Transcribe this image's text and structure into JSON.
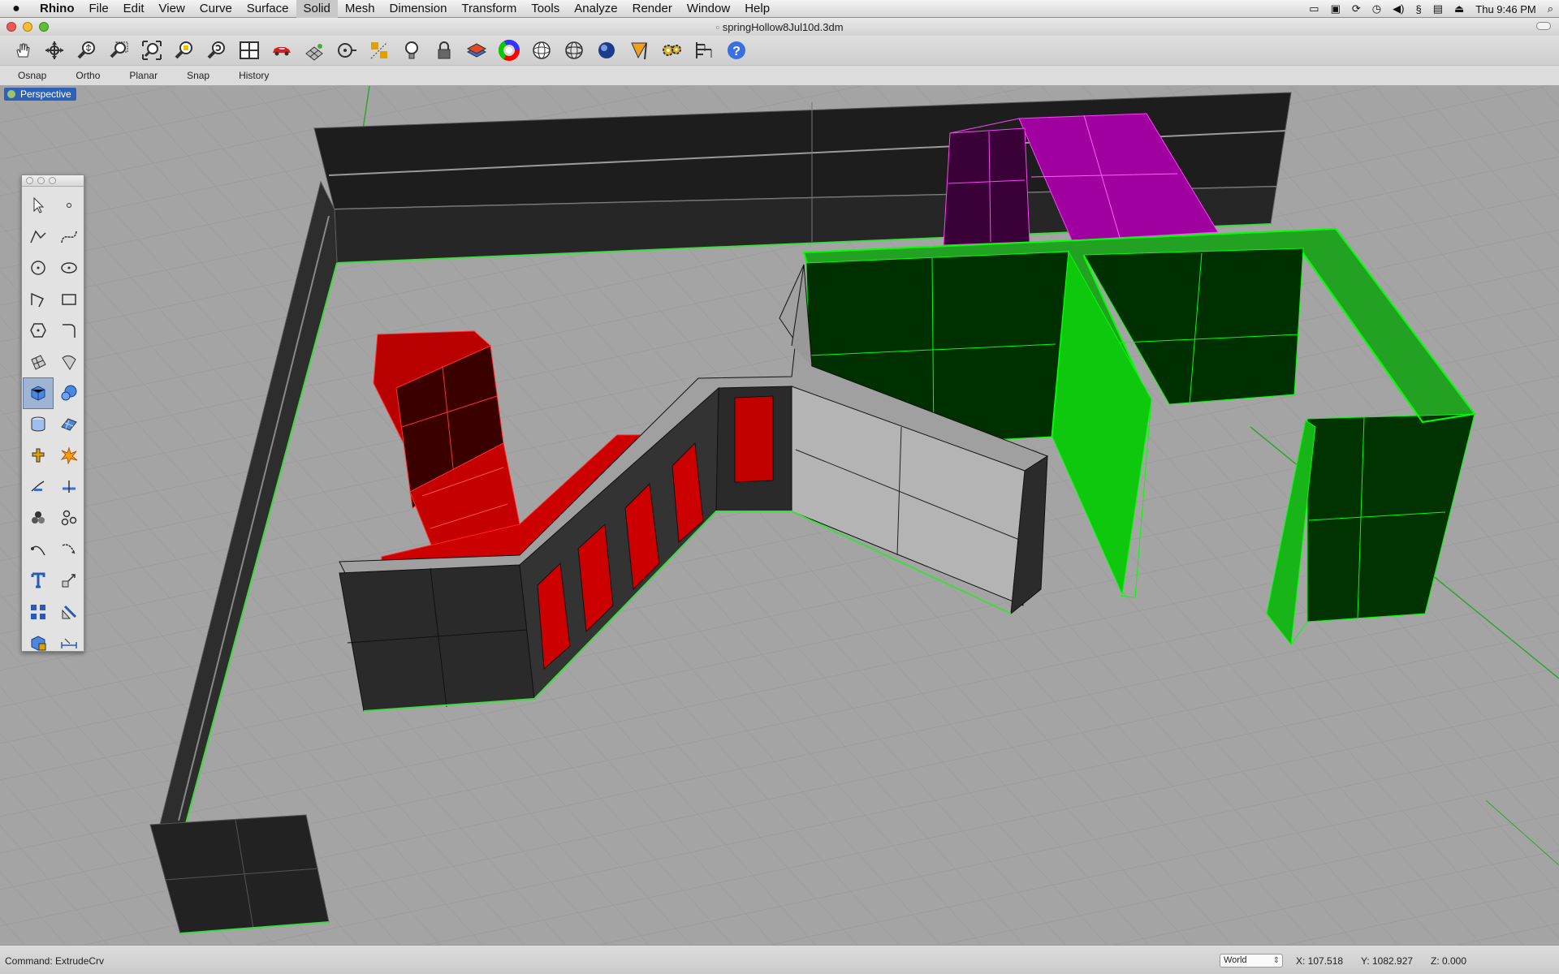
{
  "menubar": {
    "apple": "",
    "app": "Rhino",
    "items": [
      "File",
      "Edit",
      "View",
      "Curve",
      "Surface",
      "Solid",
      "Mesh",
      "Dimension",
      "Transform",
      "Tools",
      "Analyze",
      "Render",
      "Window",
      "Help"
    ],
    "active": "Solid",
    "clock": "Thu 9:46 PM"
  },
  "window": {
    "title": "springHollow8Jul10d.3dm"
  },
  "toolbar": {
    "icons": [
      "pan-icon",
      "rotate-view-icon",
      "zoom-dynamic-icon",
      "zoom-window-icon",
      "zoom-extents-icon",
      "zoom-selected-icon",
      "undo-view-icon",
      "four-viewports-icon",
      "car-icon",
      "grid-plane-icon",
      "cplane-icon",
      "snap-grid-icon",
      "light-icon",
      "lock-icon",
      "layer-icon",
      "color-wheel-icon",
      "wireframe-sphere-icon",
      "shaded-sphere-icon",
      "rendered-sphere-icon",
      "render-icon",
      "settings-gears-icon",
      "dimension-icon",
      "help-icon"
    ]
  },
  "osnapbar": {
    "items": [
      "Osnap",
      "Ortho",
      "Planar",
      "Snap",
      "History"
    ]
  },
  "viewport": {
    "label": "Perspective"
  },
  "palette": {
    "tools": [
      "select-icon",
      "point-icon",
      "polyline-icon",
      "curve-icon",
      "circle-icon",
      "ellipse-icon",
      "arc-icon",
      "rectangle-icon",
      "polygon-icon",
      "fillet-curve-icon",
      "surface-corners-icon",
      "revolve-icon",
      "box-icon",
      "sphere-icon",
      "cylinder-icon",
      "plane-icon",
      "boolean-icon",
      "explode-icon",
      "trim-icon",
      "split-icon",
      "group-icon",
      "ungroup-icon",
      "rotate-icon",
      "transform-icon",
      "text-icon",
      "scale-icon",
      "array-icon",
      "mirror-icon",
      "solid-tools-icon",
      "dimension-linear-icon"
    ],
    "selected_index": 12
  },
  "status": {
    "command": "Command:  ExtrudeCrv",
    "cplane": "World",
    "x": "X: 107.518",
    "y": "Y: 1082.927",
    "z": "Z: 0.000"
  },
  "colors": {
    "selection_green": "#00ff00",
    "wall_dark": "#242424",
    "wall_light": "#b3b3b3",
    "red_object": "#d40000",
    "magenta_object": "#cc00cc",
    "viewport_bg": "#a4a4a4"
  }
}
